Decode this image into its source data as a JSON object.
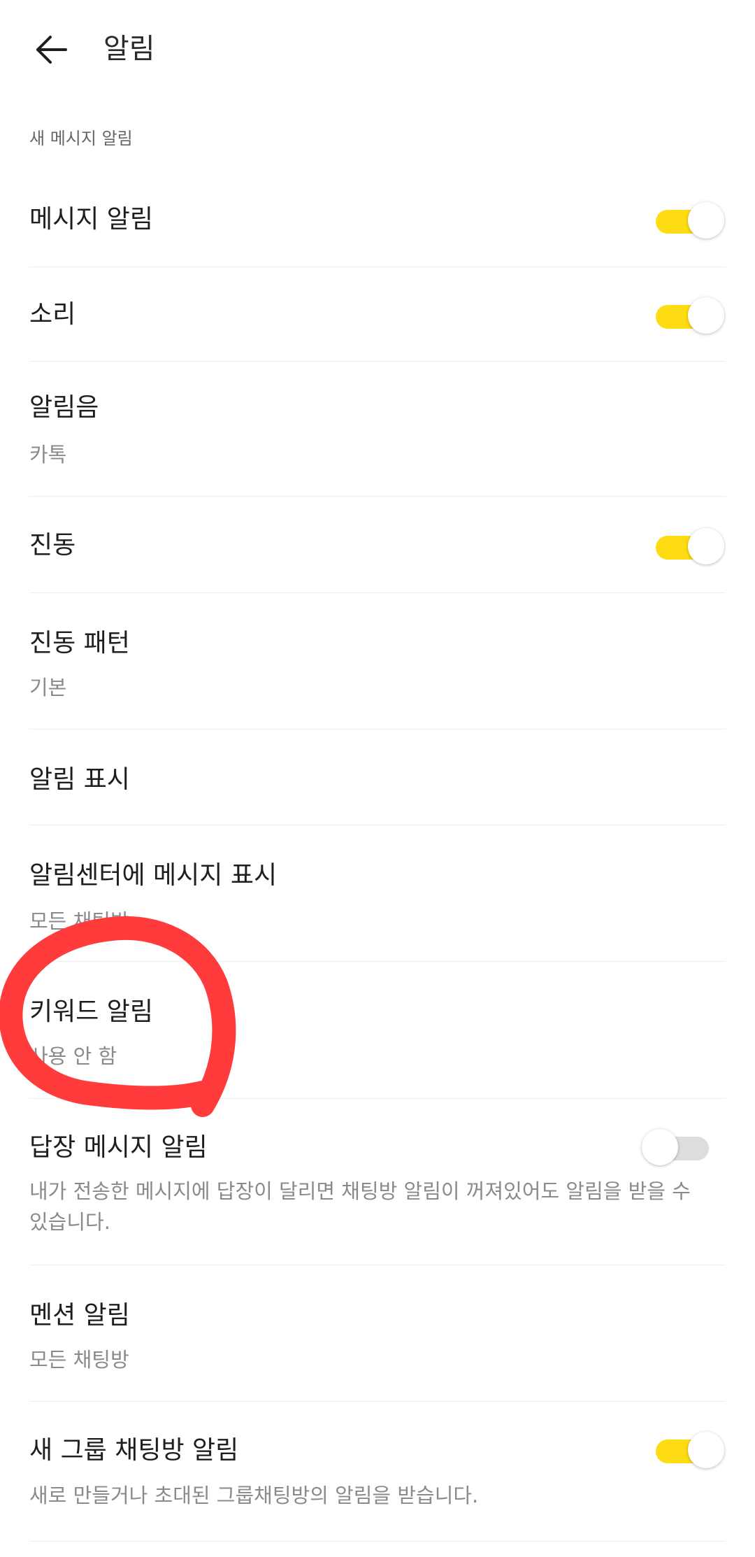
{
  "header": {
    "title": "알림",
    "back_icon": "arrow-left-icon"
  },
  "section": {
    "label": "새 메시지 알림"
  },
  "settings": {
    "message_alert": {
      "title": "메시지 알림",
      "enabled": true
    },
    "sound": {
      "title": "소리",
      "enabled": true
    },
    "ringtone": {
      "title": "알림음",
      "value": "카톡"
    },
    "vibration": {
      "title": "진동",
      "enabled": true
    },
    "vibration_pattern": {
      "title": "진동 패턴",
      "value": "기본"
    },
    "alert_display": {
      "title": "알림 표시"
    },
    "notification_center": {
      "title": "알림센터에 메시지 표시",
      "value": "모든 채팅방"
    },
    "keyword_alert": {
      "title": "키워드 알림",
      "value": "사용 안 함"
    },
    "reply_alert": {
      "title": "답장 메시지 알림",
      "description": "내가 전송한 메시지에 답장이 달리면 채팅방 알림이 꺼져있어도 알림을 받을 수 있습니다.",
      "enabled": false
    },
    "mention_alert": {
      "title": "멘션 알림",
      "value": "모든 채팅방"
    },
    "new_group_alert": {
      "title": "새 그룹 채팅방 알림",
      "description": "새로 만들거나 초대된 그룹채팅방의 알림을 받습니다.",
      "enabled": true
    }
  },
  "colors": {
    "toggle_on": "#fddc13",
    "toggle_off": "#dddddd",
    "annotation": "#ff3b3b"
  }
}
